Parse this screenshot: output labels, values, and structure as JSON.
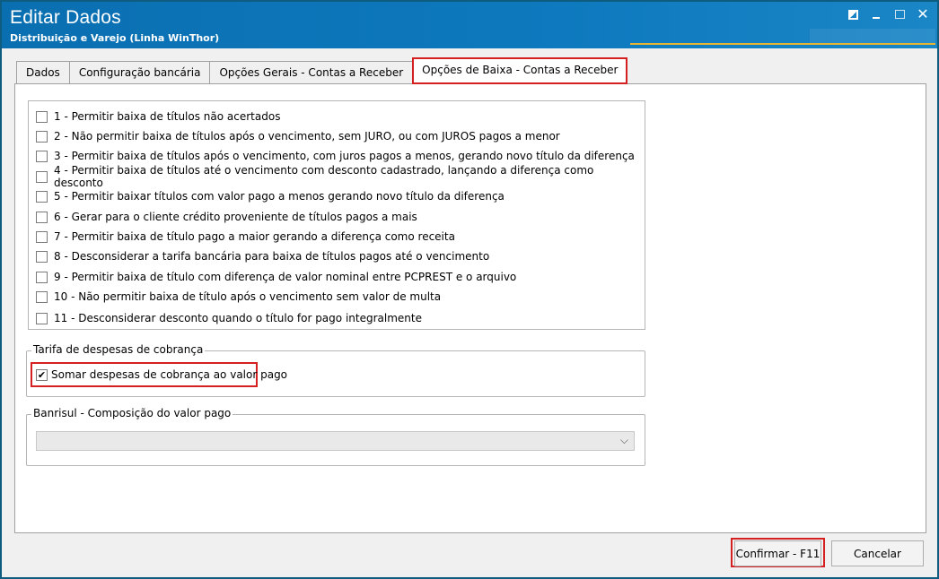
{
  "window": {
    "title": "Editar Dados",
    "subtitle": "Distribuição e Varejo (Linha WinThor)"
  },
  "tabs": [
    {
      "label": "Dados"
    },
    {
      "label": "Configuração bancária"
    },
    {
      "label": "Opções Gerais - Contas a Receber"
    },
    {
      "label": "Opções de Baixa - Contas a Receber"
    }
  ],
  "options": [
    {
      "label": "1 - Permitir baixa de títulos não acertados",
      "checked": false
    },
    {
      "label": "2 - Não permitir baixa de títulos após o vencimento, sem JURO, ou com JUROS pagos a menor",
      "checked": false
    },
    {
      "label": "3 - Permitir baixa de títulos após o vencimento, com juros pagos a menos, gerando novo título da diferença",
      "checked": false
    },
    {
      "label": "4 - Permitir baixa de títulos até o vencimento com desconto cadastrado, lançando a diferença como desconto",
      "checked": false
    },
    {
      "label": "5 - Permitir baixar títulos com valor pago a menos gerando novo título da diferença",
      "checked": false
    },
    {
      "label": "6 - Gerar para o cliente crédito proveniente de títulos pagos a mais",
      "checked": false
    },
    {
      "label": "7 - Permitir baixa de título pago a maior gerando a diferença como receita",
      "checked": false
    },
    {
      "label": "8 - Desconsiderar a tarifa bancária para baixa de títulos pagos até o vencimento",
      "checked": false
    },
    {
      "label": "9 - Permitir baixa de título com diferença de valor nominal entre PCPREST e o arquivo",
      "checked": false
    },
    {
      "label": "10 - Não permitir baixa de título após o vencimento sem valor de multa",
      "checked": false
    },
    {
      "label": "11 - Desconsiderar desconto quando o título for pago integralmente",
      "checked": false
    }
  ],
  "tarifa_group": {
    "label": "Tarifa de despesas de cobrança",
    "checkbox_label": "Somar despesas de cobrança ao valor pago",
    "checked": true
  },
  "banrisul_group": {
    "label": "Banrisul - Composição do valor pago",
    "selected_value": ""
  },
  "buttons": {
    "confirm": "Confirmar - F11",
    "cancel": "Cancelar"
  },
  "colors": {
    "titlebar": "#0a6fb1",
    "highlight": "#d42020",
    "accent": "#e8b631"
  }
}
